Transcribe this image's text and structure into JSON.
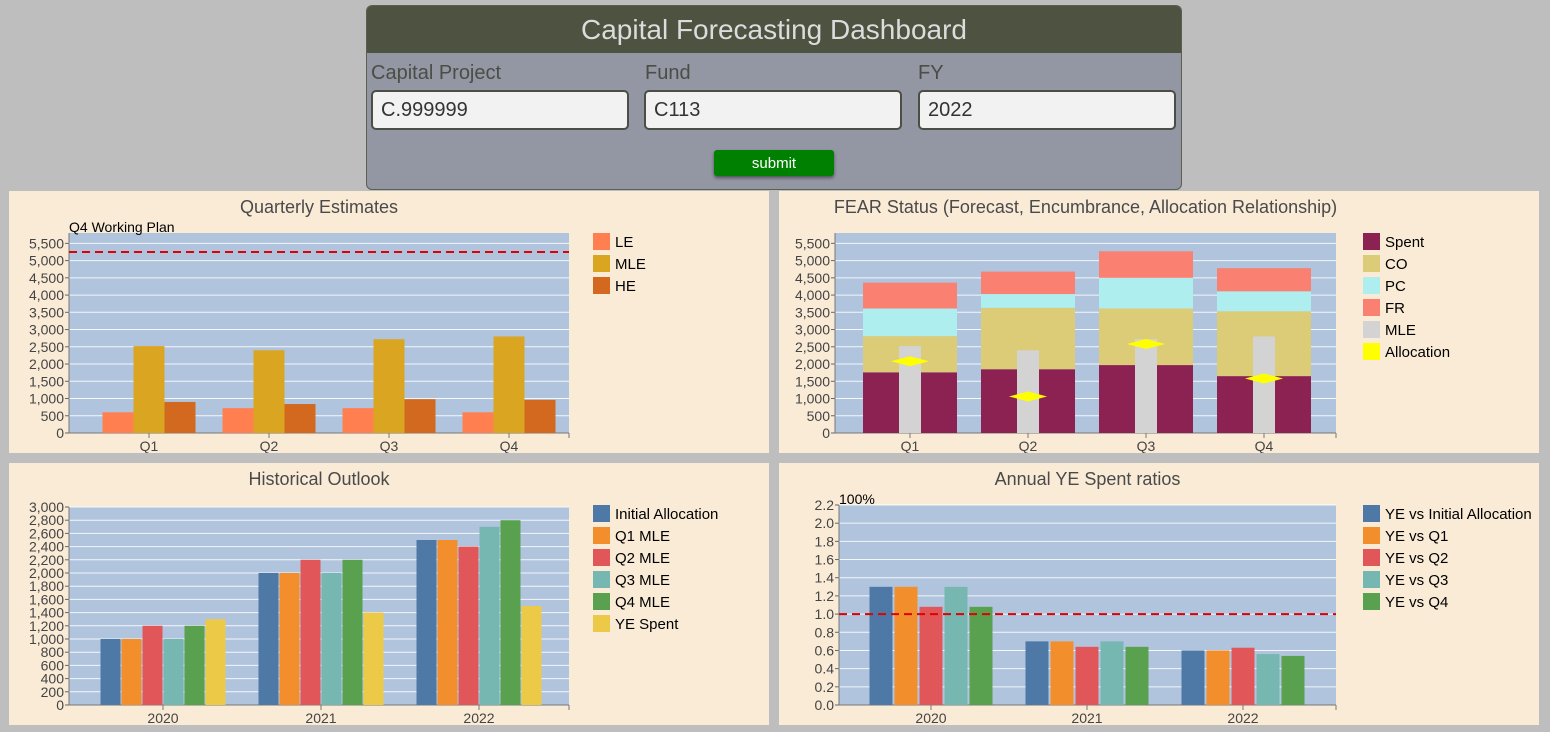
{
  "form": {
    "title": "Capital Forecasting Dashboard",
    "fields": [
      {
        "label": "Capital Project",
        "value": "C.999999"
      },
      {
        "label": "Fund",
        "value": "C113"
      },
      {
        "label": "FY",
        "value": "2022"
      }
    ],
    "submit_label": "submit"
  },
  "colors": {
    "page_background": "#bebebe",
    "header": "#4d5241",
    "form_body": "#9396a3",
    "panel_background": "#faebd7",
    "plot_background": "#b0c4de",
    "submit": "#008000",
    "reference_line": "#e00000"
  },
  "chart_data": [
    {
      "type": "bar",
      "title": "Quarterly Estimates",
      "categories": [
        "Q1",
        "Q2",
        "Q3",
        "Q4"
      ],
      "series": [
        {
          "name": "LE",
          "color": "#ff7f50",
          "values": [
            600,
            720,
            720,
            600
          ]
        },
        {
          "name": "MLE",
          "color": "#daa520",
          "values": [
            2520,
            2400,
            2720,
            2800
          ]
        },
        {
          "name": "HE",
          "color": "#d2691e",
          "values": [
            900,
            840,
            980,
            960
          ]
        }
      ],
      "reference_line": {
        "label": "Q4 Working Plan",
        "value": 5250
      },
      "ylim": [
        0,
        5800
      ],
      "yticks": [
        0,
        500,
        1000,
        1500,
        2000,
        2500,
        3000,
        3500,
        4000,
        4500,
        5000,
        5500
      ],
      "yticklabels": [
        "0",
        "500",
        "1,000",
        "1,500",
        "2,000",
        "2,500",
        "3,000",
        "3,500",
        "4,000",
        "4,500",
        "5,000",
        "5,500"
      ],
      "grid": true,
      "legend": "right"
    },
    {
      "type": "bar",
      "stacked": true,
      "title": "FEAR Status (Forecast, Encumbrance, Allocation Relationship)",
      "categories": [
        "Q1",
        "Q2",
        "Q3",
        "Q4"
      ],
      "series": [
        {
          "name": "Spent",
          "color": "#8b2252",
          "values": [
            1760,
            1850,
            1970,
            1650
          ]
        },
        {
          "name": "CO",
          "color": "#ddcc77",
          "values": [
            1050,
            1780,
            1640,
            1880
          ]
        },
        {
          "name": "PC",
          "color": "#afeeee",
          "values": [
            800,
            400,
            890,
            580
          ]
        },
        {
          "name": "FR",
          "color": "#fa8072",
          "values": [
            750,
            650,
            770,
            670
          ]
        }
      ],
      "overlay_bars": {
        "name": "MLE",
        "color": "#d3d3d3",
        "values": [
          2520,
          2400,
          2720,
          2800
        ]
      },
      "markers": {
        "name": "Allocation",
        "color": "#ffff00",
        "shape": "diamond",
        "values": [
          2080,
          1060,
          2580,
          1580
        ]
      },
      "legend_entries": [
        "Spent",
        "CO",
        "PC",
        "FR",
        "MLE",
        "Allocation"
      ],
      "legend_colors": [
        "#8b2252",
        "#ddcc77",
        "#afeeee",
        "#fa8072",
        "#d3d3d3",
        "#ffff00"
      ],
      "ylim": [
        0,
        5800
      ],
      "yticks": [
        0,
        500,
        1000,
        1500,
        2000,
        2500,
        3000,
        3500,
        4000,
        4500,
        5000,
        5500
      ],
      "yticklabels": [
        "0",
        "500",
        "1,000",
        "1,500",
        "2,000",
        "2,500",
        "3,000",
        "3,500",
        "4,000",
        "4,500",
        "5,000",
        "5,500"
      ],
      "grid": true,
      "legend": "right"
    },
    {
      "type": "bar",
      "title": "Historical Outlook",
      "categories": [
        "2020",
        "2021",
        "2022"
      ],
      "series": [
        {
          "name": "Initial Allocation",
          "color": "#4e79a7",
          "values": [
            1000,
            2000,
            2500
          ]
        },
        {
          "name": "Q1 MLE",
          "color": "#f28e2b",
          "values": [
            1000,
            2000,
            2500
          ]
        },
        {
          "name": "Q2 MLE",
          "color": "#e15759",
          "values": [
            1200,
            2200,
            2400
          ]
        },
        {
          "name": "Q3 MLE",
          "color": "#76b7b2",
          "values": [
            1000,
            2000,
            2700
          ]
        },
        {
          "name": "Q4 MLE",
          "color": "#59a14f",
          "values": [
            1200,
            2200,
            2800
          ]
        },
        {
          "name": "YE Spent",
          "color": "#edc948",
          "values": [
            1300,
            1400,
            1500
          ]
        }
      ],
      "ylim": [
        0,
        3000
      ],
      "yticks": [
        0,
        200,
        400,
        600,
        800,
        1000,
        1200,
        1400,
        1600,
        1800,
        2000,
        2200,
        2400,
        2600,
        2800,
        3000
      ],
      "yticklabels": [
        "0",
        "200",
        "400",
        "600",
        "800",
        "1,000",
        "1,200",
        "1,400",
        "1,600",
        "1,800",
        "2,000",
        "2,200",
        "2,400",
        "2,600",
        "2,800",
        "3,000"
      ],
      "grid": true,
      "legend": "right"
    },
    {
      "type": "bar",
      "title": "Annual YE Spent ratios",
      "categories": [
        "2020",
        "2021",
        "2022"
      ],
      "series": [
        {
          "name": "YE vs Initial Allocation",
          "color": "#4e79a7",
          "values": [
            1.3,
            0.7,
            0.6
          ]
        },
        {
          "name": "YE vs Q1",
          "color": "#f28e2b",
          "values": [
            1.3,
            0.7,
            0.6
          ]
        },
        {
          "name": "YE vs Q2",
          "color": "#e15759",
          "values": [
            1.08,
            0.64,
            0.63
          ]
        },
        {
          "name": "YE vs Q3",
          "color": "#76b7b2",
          "values": [
            1.3,
            0.7,
            0.56
          ]
        },
        {
          "name": "YE vs Q4",
          "color": "#59a14f",
          "values": [
            1.08,
            0.64,
            0.54
          ]
        }
      ],
      "reference_line": {
        "label": "100%",
        "value": 1.0
      },
      "ylim": [
        0,
        2.2
      ],
      "yticks": [
        0,
        0.2,
        0.4,
        0.6,
        0.8,
        1.0,
        1.2,
        1.4,
        1.6,
        1.8,
        2.0,
        2.2
      ],
      "yticklabels": [
        "0.0",
        "0.2",
        "0.4",
        "0.6",
        "0.8",
        "1.0",
        "1.2",
        "1.4",
        "1.6",
        "1.8",
        "2.0",
        "2.2"
      ],
      "grid": true,
      "legend": "right"
    }
  ]
}
